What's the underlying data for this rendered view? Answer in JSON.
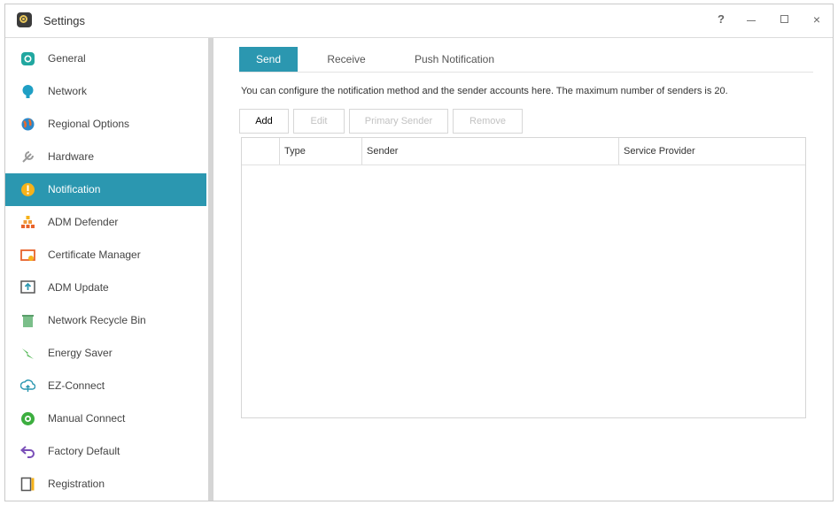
{
  "window": {
    "title": "Settings",
    "controls": {
      "help": "?",
      "minimize": "",
      "maximize": "",
      "close": "×"
    }
  },
  "sidebar": {
    "items": [
      {
        "label": "General",
        "icon": "general-icon",
        "active": false
      },
      {
        "label": "Network",
        "icon": "network-icon",
        "active": false
      },
      {
        "label": "Regional Options",
        "icon": "regional-options-icon",
        "active": false
      },
      {
        "label": "Hardware",
        "icon": "hardware-icon",
        "active": false
      },
      {
        "label": "Notification",
        "icon": "notification-icon",
        "active": true
      },
      {
        "label": "ADM Defender",
        "icon": "adm-defender-icon",
        "active": false
      },
      {
        "label": "Certificate Manager",
        "icon": "certificate-manager-icon",
        "active": false
      },
      {
        "label": "ADM Update",
        "icon": "adm-update-icon",
        "active": false
      },
      {
        "label": "Network Recycle Bin",
        "icon": "recycle-bin-icon",
        "active": false
      },
      {
        "label": "Energy Saver",
        "icon": "energy-saver-icon",
        "active": false
      },
      {
        "label": "EZ-Connect",
        "icon": "ez-connect-icon",
        "active": false
      },
      {
        "label": "Manual Connect",
        "icon": "manual-connect-icon",
        "active": false
      },
      {
        "label": "Factory Default",
        "icon": "factory-default-icon",
        "active": false
      },
      {
        "label": "Registration",
        "icon": "registration-icon",
        "active": false
      }
    ]
  },
  "tabs": [
    {
      "label": "Send",
      "active": true
    },
    {
      "label": "Receive",
      "active": false
    },
    {
      "label": "Push Notification",
      "active": false
    }
  ],
  "description": "You can configure the notification method and the sender accounts here. The maximum number of senders is 20.",
  "toolbar": {
    "add": "Add",
    "edit": "Edit",
    "primary_sender": "Primary Sender",
    "remove": "Remove"
  },
  "table": {
    "columns": [
      "",
      "Type",
      "Sender",
      "Service Provider"
    ],
    "rows": []
  },
  "colors": {
    "accent": "#2b97b0",
    "disabled_text": "#c2c2c2"
  }
}
